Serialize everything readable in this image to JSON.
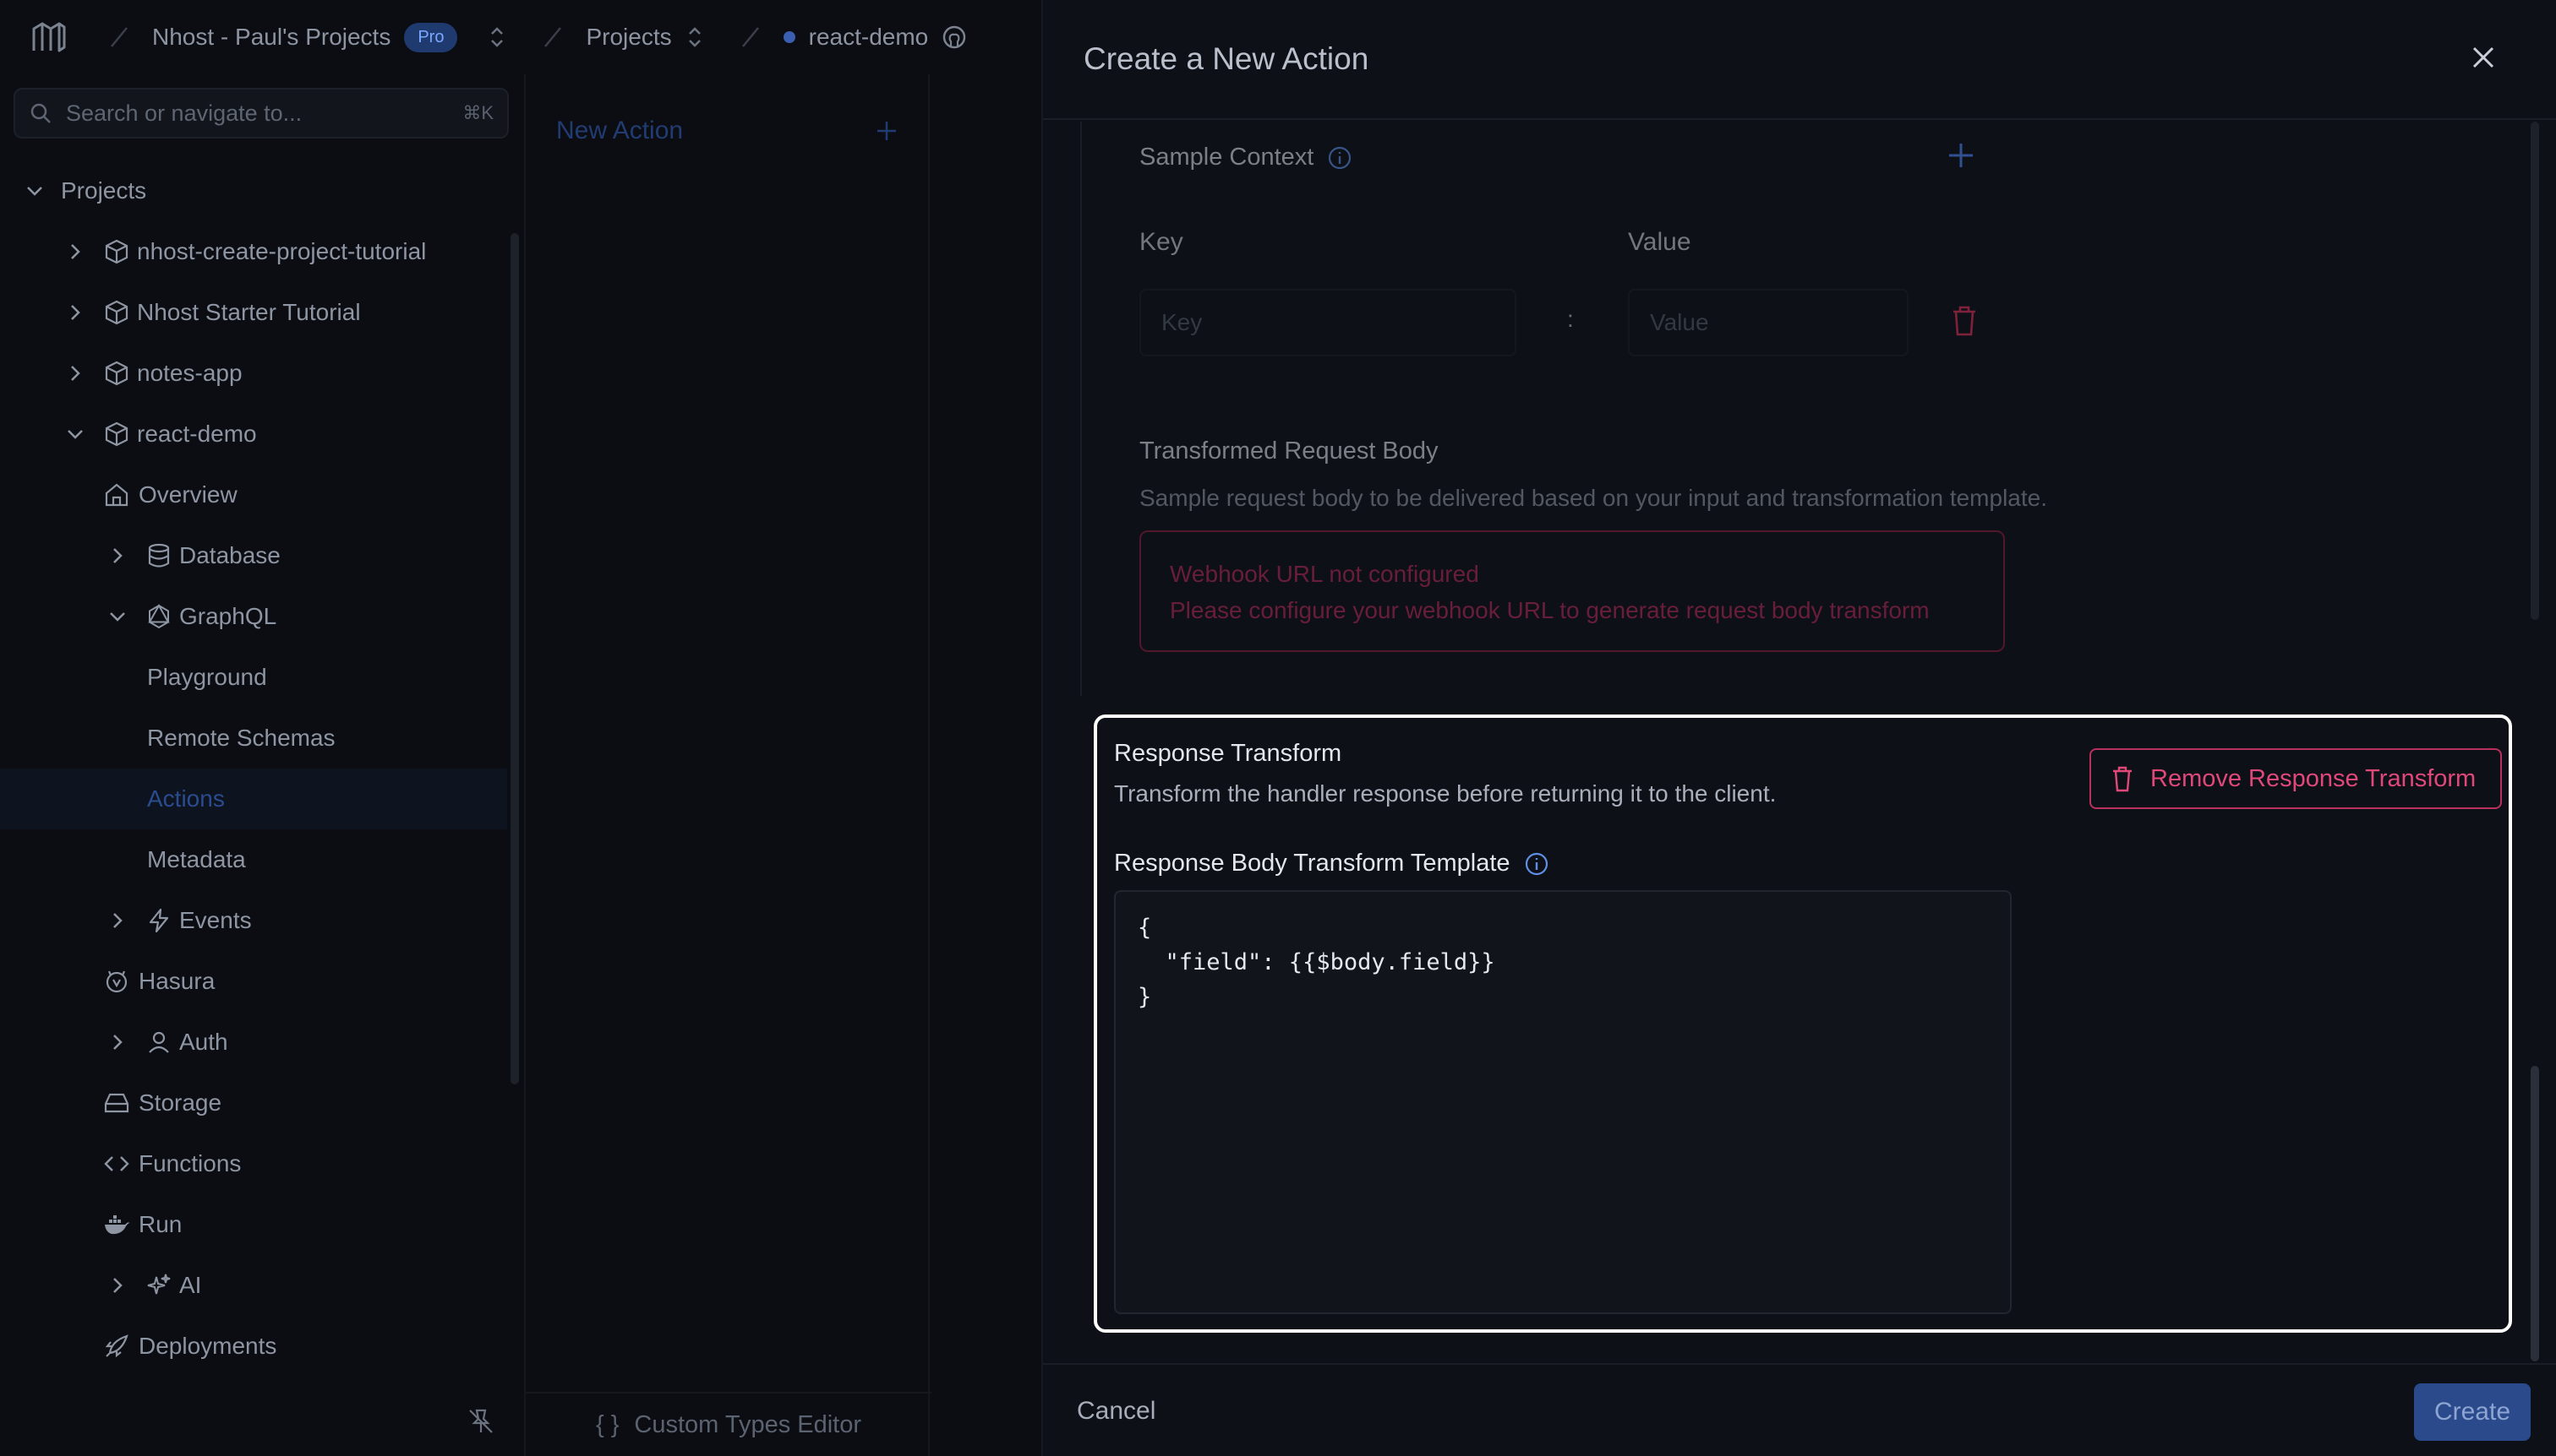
{
  "topbar": {
    "org": "Nhost - Paul's Projects",
    "badge": "Pro",
    "projects": "Projects",
    "project": "react-demo"
  },
  "search": {
    "placeholder": "Search or navigate to...",
    "shortcut": "⌘K"
  },
  "tree": {
    "projects": "Projects",
    "p1": "nhost-create-project-tutorial",
    "p2": "Nhost Starter Tutorial",
    "p3": "notes-app",
    "p4": "react-demo",
    "overview": "Overview",
    "database": "Database",
    "graphql": "GraphQL",
    "playground": "Playground",
    "remote": "Remote Schemas",
    "actions": "Actions",
    "metadata": "Metadata",
    "events": "Events",
    "hasura": "Hasura",
    "auth": "Auth",
    "storage": "Storage",
    "functions": "Functions",
    "run": "Run",
    "ai": "AI",
    "deployments": "Deployments"
  },
  "middle": {
    "new_action": "New Action",
    "custom_types": "Custom Types Editor"
  },
  "drawer": {
    "title": "Create a New Action",
    "sample_context": "Sample Context",
    "key_label": "Key",
    "value_label": "Value",
    "key_placeholder": "Key",
    "value_placeholder": "Value",
    "trb_title": "Transformed Request Body",
    "trb_desc": "Sample request body to be delivered based on your input and transformation template.",
    "warn_title": "Webhook URL not configured",
    "warn_desc": "Please configure your webhook URL to generate request body transform",
    "rt_title": "Response Transform",
    "rt_desc": "Transform the handler response before returning it to the client.",
    "rt_remove": "Remove Response Transform",
    "rbt_label": "Response Body Transform Template",
    "template": "{\n  \"field\": {{$body.field}}\n}",
    "cancel": "Cancel",
    "create": "Create"
  }
}
